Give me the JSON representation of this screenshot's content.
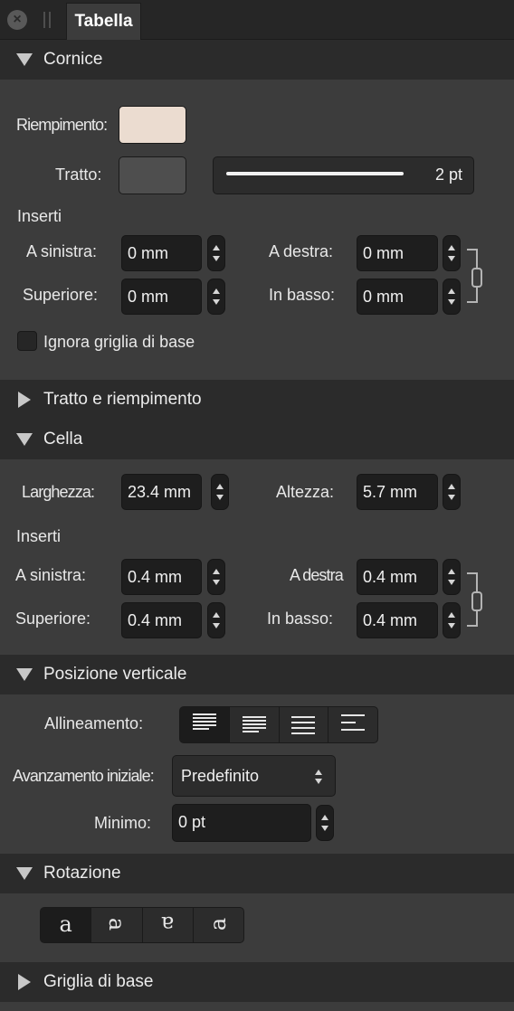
{
  "tab": {
    "title": "Tabella"
  },
  "colors": {
    "fill_swatch": "#ebdcd0",
    "stroke_swatch": "#4e4e4e",
    "panel_bg": "#3c3c3c",
    "header_bg": "#2b2b2b"
  },
  "cornice": {
    "title": "Cornice",
    "fill_label": "Riempimento:",
    "stroke_label": "Tratto:",
    "stroke_width": "2 pt",
    "insets_label": "Inserti",
    "left_label": "A sinistra:",
    "left_value": "0 mm",
    "right_label": "A destra:",
    "right_value": "0 mm",
    "top_label": "Superiore:",
    "top_value": "0 mm",
    "bottom_label": "In basso:",
    "bottom_value": "0 mm",
    "ignore_baseline_label": "Ignora griglia di base"
  },
  "stroke_fill": {
    "title": "Tratto e riempimento"
  },
  "cella": {
    "title": "Cella",
    "width_label": "Larghezza:",
    "width_value": "23.4 mm",
    "height_label": "Altezza:",
    "height_value": "5.7 mm",
    "insets_label": "Inserti",
    "left_label": "A sinistra:",
    "left_value": "0.4 mm",
    "right_label": "A destra",
    "right_value": "0.4 mm",
    "top_label": "Superiore:",
    "top_value": "0.4 mm",
    "bottom_label": "In basso:",
    "bottom_value": "0.4 mm"
  },
  "vertical": {
    "title": "Posizione verticale",
    "alignment_label": "Allineamento:",
    "alignment_icons": [
      "align-top-icon",
      "align-center-icon",
      "align-justify-icon",
      "align-bottom-icon"
    ],
    "first_advance_label": "Avanzamento iniziale:",
    "first_advance_value": "Predefinito",
    "minimum_label": "Minimo:",
    "minimum_value": "0 pt"
  },
  "rotation": {
    "title": "Rotazione",
    "glyphs": [
      "a",
      "a",
      "a",
      "a"
    ],
    "icons": [
      "rotate-0-icon",
      "rotate-90-icon",
      "rotate-180-icon",
      "rotate-270-icon"
    ]
  },
  "baseline": {
    "title": "Griglia di base"
  }
}
